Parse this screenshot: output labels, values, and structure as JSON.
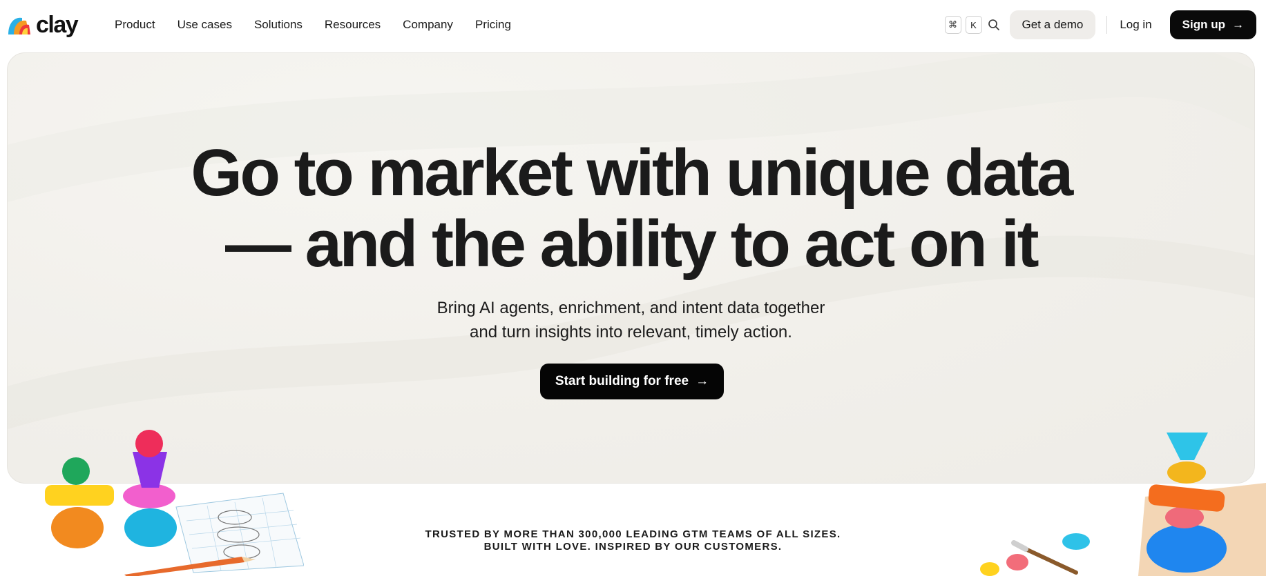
{
  "brand": {
    "name": "clay"
  },
  "nav": {
    "links": [
      "Product",
      "Use cases",
      "Solutions",
      "Resources",
      "Company",
      "Pricing"
    ],
    "shortcut_keys": [
      "⌘",
      "K"
    ],
    "demo_label": "Get a demo",
    "login_label": "Log in",
    "signup_label": "Sign up"
  },
  "hero": {
    "title_line1": "Go to market with unique data",
    "title_line2": "— and the ability to act on it",
    "subtitle_line1": "Bring AI agents, enrichment, and intent data together",
    "subtitle_line2": "and turn insights into relevant, timely action.",
    "cta_label": "Start building for free"
  },
  "trusted": {
    "line1": "TRUSTED BY MORE THAN 300,000 LEADING GTM TEAMS OF ALL SIZES.",
    "line2": "BUILT WITH LOVE. INSPIRED BY OUR CUSTOMERS."
  },
  "icons": [
    "clay-logo-icon",
    "search-icon",
    "arrow-right-icon"
  ],
  "colors": {
    "dark_button": "#0a0a0a",
    "demo_button": "#efedea",
    "hero_bg": "#f2f0ec"
  }
}
